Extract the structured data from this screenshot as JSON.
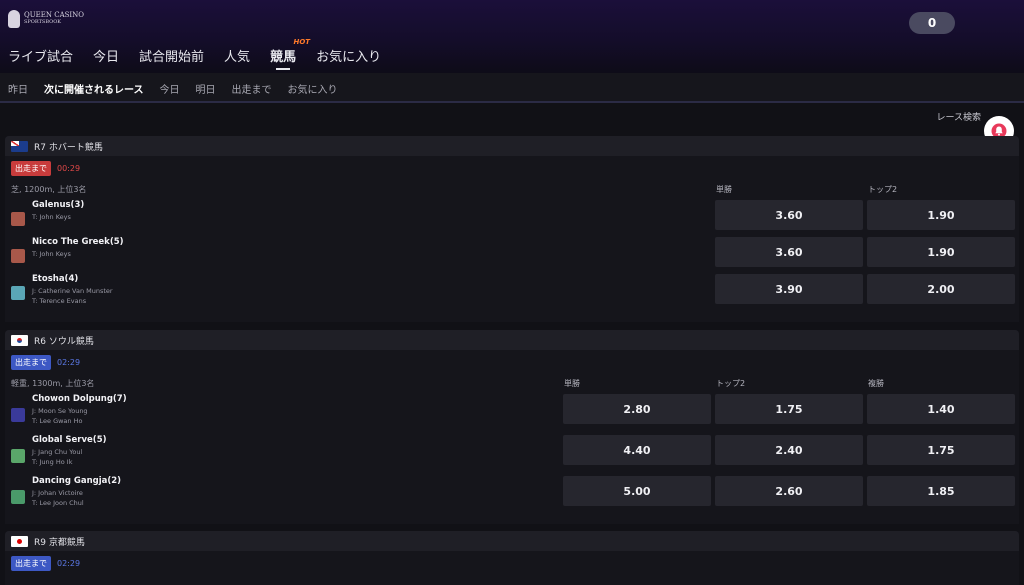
{
  "header": {
    "logo_line1": "QUEEN CASINO",
    "logo_line2": "SPORTSBOOK",
    "balance": "0",
    "nav": [
      {
        "label": "ライブ試合"
      },
      {
        "label": "今日"
      },
      {
        "label": "試合開始前"
      },
      {
        "label": "人気"
      },
      {
        "label": "競馬",
        "hot": "HOT"
      },
      {
        "label": "お気に入り"
      }
    ]
  },
  "subnav": [
    "昨日",
    "次に開催されるレース",
    "今日",
    "明日",
    "出走まで",
    "お気に入り"
  ],
  "race_search": "レース検索",
  "colors": {
    "accent_red": "#c83c3c",
    "accent_blue": "#3d58c4",
    "odds_bg": "#26262e"
  },
  "races": [
    {
      "flag": "flag-au-icon",
      "title": "R7 ホバート競馬",
      "badge": "出走まで",
      "time": "00:29",
      "meta": "芝, 1200m, 上位3名",
      "columns": [
        "単勝",
        "トップ2"
      ],
      "runners": [
        {
          "name": "Galenus(3)",
          "lines": [
            "T: John Keys"
          ],
          "silk": "#a8584a",
          "odds": [
            "3.60",
            "1.90"
          ]
        },
        {
          "name": "Nicco The Greek(5)",
          "lines": [
            "T: John Keys"
          ],
          "silk": "#a8584a",
          "odds": [
            "3.60",
            "1.90"
          ]
        },
        {
          "name": "Etosha(4)",
          "lines": [
            "J: Catherine Van Munster",
            "T: Terence Evans"
          ],
          "silk": "#5aa6b6",
          "odds": [
            "3.90",
            "2.00"
          ]
        }
      ]
    },
    {
      "flag": "flag-kr-icon",
      "title": "R6 ソウル競馬",
      "badge": "出走まで",
      "time": "02:29",
      "meta": "軽重, 1300m, 上位3名",
      "columns": [
        "単勝",
        "トップ2",
        "複勝"
      ],
      "runners": [
        {
          "name": "Chowon Dolpung(7)",
          "lines": [
            "J: Moon Se Young",
            "T: Lee Gwan Ho"
          ],
          "silk": "#3a3a9a",
          "odds": [
            "2.80",
            "1.75",
            "1.40"
          ]
        },
        {
          "name": "Global Serve(5)",
          "lines": [
            "J: Jang Chu Youl",
            "T: Jung Ho Ik"
          ],
          "silk": "#5aa66a",
          "odds": [
            "4.40",
            "2.40",
            "1.75"
          ]
        },
        {
          "name": "Dancing Gangja(2)",
          "lines": [
            "J: Johan Victoire",
            "T: Lee Joon Chul"
          ],
          "silk": "#4a9a6a",
          "odds": [
            "5.00",
            "2.60",
            "1.85"
          ]
        }
      ]
    },
    {
      "flag": "flag-jp-icon",
      "title": "R9 京都競馬",
      "badge": "出走まで",
      "time": "02:29"
    }
  ]
}
